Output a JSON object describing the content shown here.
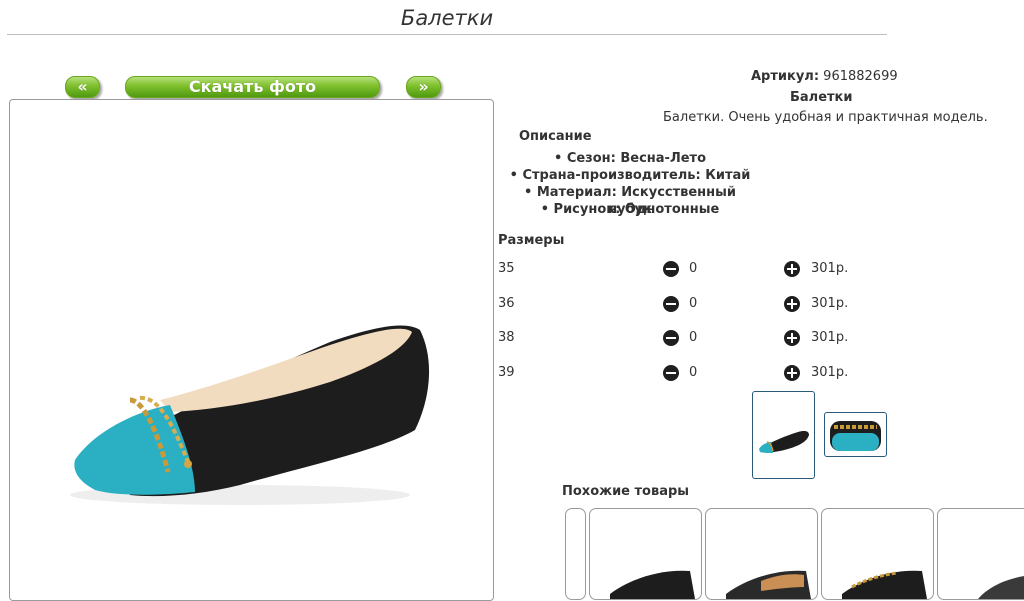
{
  "page": {
    "title": "Балетки"
  },
  "nav": {
    "prev_label": "«",
    "download_label": "Скачать фото",
    "next_label": "»"
  },
  "product": {
    "article_label": "Артикул:",
    "article_value": "961882699",
    "name": "Балетки",
    "description": "Балетки. Очень удобная и практичная модель."
  },
  "description_section": {
    "heading": "Описание",
    "items": [
      "Сезон: Весна-Лето",
      "Страна-производитель: Китай",
      "Материал: Искусственный нубук",
      "Рисунок: Однотонные"
    ]
  },
  "sizes": {
    "heading": "Размеры",
    "rows": [
      {
        "size": "35",
        "qty": "0",
        "price": "301р."
      },
      {
        "size": "36",
        "qty": "0",
        "price": "301р."
      },
      {
        "size": "38",
        "qty": "0",
        "price": "301р."
      },
      {
        "size": "39",
        "qty": "0",
        "price": "301р."
      }
    ]
  },
  "similar": {
    "heading": "Похожие товары"
  },
  "colors": {
    "accent_green": "#7fbf2c",
    "shoe_black": "#1a1a1a",
    "shoe_turquoise": "#2bb0c3",
    "chain_gold": "#c89a3a"
  }
}
